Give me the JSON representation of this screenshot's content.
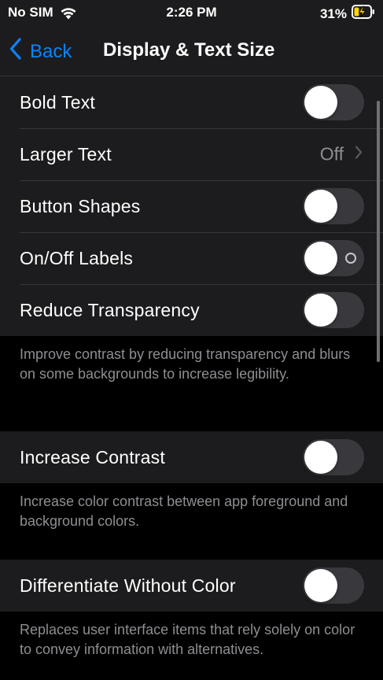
{
  "status_bar": {
    "carrier": "No SIM",
    "time": "2:26 PM",
    "battery_percent": "31%",
    "wifi_icon": "wifi-icon",
    "battery_icon": "battery-charging-icon",
    "battery_level": 0.31,
    "battery_fill_color": "#ffd60a"
  },
  "nav": {
    "back_label": "Back",
    "title": "Display & Text Size",
    "accent_color": "#0a84ff"
  },
  "group1": {
    "rows": [
      {
        "label": "Bold Text",
        "type": "toggle",
        "on": false
      },
      {
        "label": "Larger Text",
        "type": "link",
        "value": "Off"
      },
      {
        "label": "Button Shapes",
        "type": "toggle",
        "on": false
      },
      {
        "label": "On/Off Labels",
        "type": "toggle",
        "on": false,
        "shows_off_label": true
      },
      {
        "label": "Reduce Transparency",
        "type": "toggle",
        "on": false
      }
    ],
    "footer": "Improve contrast by reducing transparency and blurs on some backgrounds to increase legibility."
  },
  "group2": {
    "rows": [
      {
        "label": "Increase Contrast",
        "type": "toggle",
        "on": false
      }
    ],
    "footer": "Increase color contrast between app foreground and background colors."
  },
  "group3": {
    "rows": [
      {
        "label": "Differentiate Without Color",
        "type": "toggle",
        "on": false
      }
    ],
    "footer": "Replaces user interface items that rely solely on color to convey information with alternatives."
  }
}
